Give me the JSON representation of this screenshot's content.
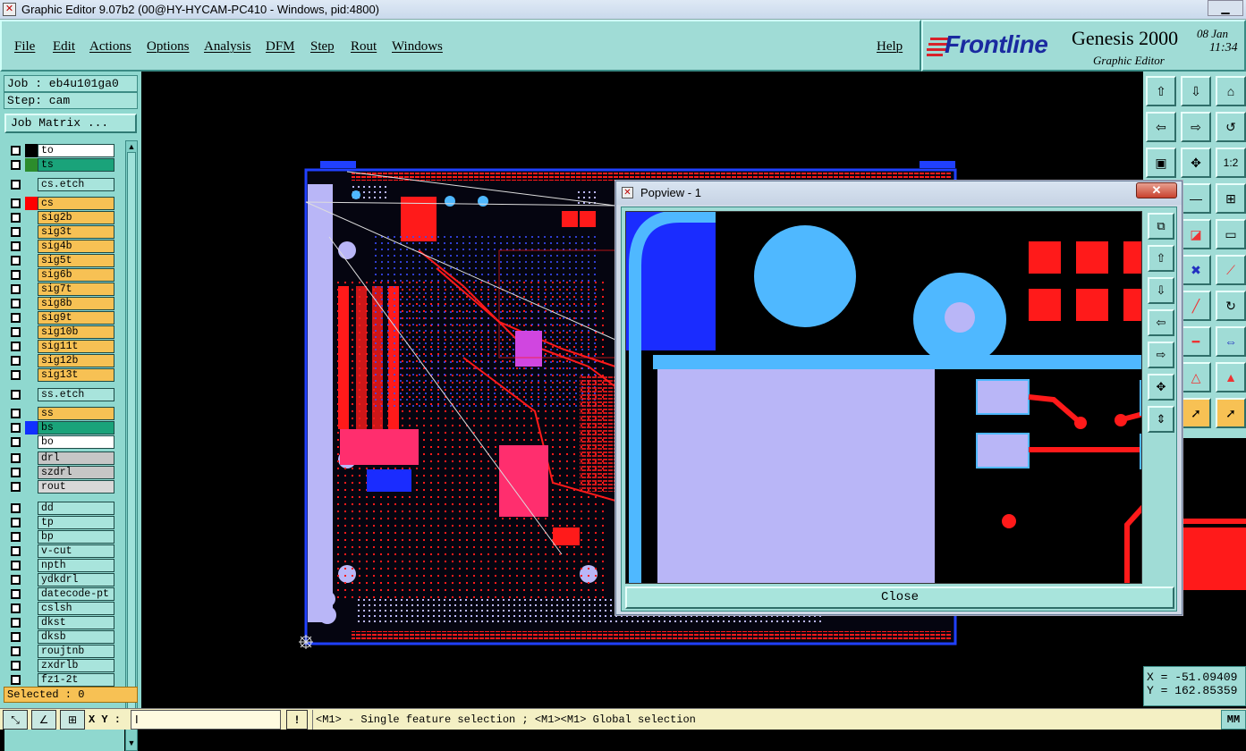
{
  "window": {
    "title": "Graphic Editor 9.07b2 (00@HY-HYCAM-PC410 - Windows, pid:4800)",
    "app_icon": "x-logo-icon"
  },
  "menu": {
    "items": [
      "File",
      "Edit",
      "Actions",
      "Options",
      "Analysis",
      "DFM",
      "Step",
      "Rout",
      "Windows"
    ],
    "help": "Help"
  },
  "brand": {
    "logo": "Frontline",
    "product": "Genesis 2000",
    "subtitle": "Graphic Editor",
    "date": "08 Jan",
    "time": "11:34"
  },
  "job": {
    "job_label": "Job : eb4u101ga0",
    "step_label": "Step: cam",
    "matrix_button": "Job Matrix ..."
  },
  "layers": [
    {
      "name": "to",
      "color": "#ffffff",
      "swatch": "#000000",
      "group": 0
    },
    {
      "name": "ts",
      "color": "#1aa37a",
      "swatch": "#2c8c2c",
      "group": 0
    },
    {
      "name": "cs.etch",
      "color": "#a8e4dc",
      "swatch": "",
      "group": 1
    },
    {
      "name": "cs",
      "color": "#f7c154",
      "swatch": "#ff0000",
      "group": 2
    },
    {
      "name": "sig2b",
      "color": "#f7c154",
      "swatch": "",
      "group": 2
    },
    {
      "name": "sig3t",
      "color": "#f7c154",
      "swatch": "",
      "group": 2
    },
    {
      "name": "sig4b",
      "color": "#f7c154",
      "swatch": "",
      "group": 2
    },
    {
      "name": "sig5t",
      "color": "#f7c154",
      "swatch": "",
      "group": 2
    },
    {
      "name": "sig6b",
      "color": "#f7c154",
      "swatch": "",
      "group": 2
    },
    {
      "name": "sig7t",
      "color": "#f7c154",
      "swatch": "",
      "group": 2
    },
    {
      "name": "sig8b",
      "color": "#f7c154",
      "swatch": "",
      "group": 2
    },
    {
      "name": "sig9t",
      "color": "#f7c154",
      "swatch": "",
      "group": 2
    },
    {
      "name": "sig10b",
      "color": "#f7c154",
      "swatch": "",
      "group": 2
    },
    {
      "name": "sig11t",
      "color": "#f7c154",
      "swatch": "",
      "group": 2
    },
    {
      "name": "sig12b",
      "color": "#f7c154",
      "swatch": "",
      "group": 2
    },
    {
      "name": "sig13t",
      "color": "#f7c154",
      "swatch": "",
      "group": 2
    },
    {
      "name": "ss.etch",
      "color": "#a8e4dc",
      "swatch": "",
      "group": 3
    },
    {
      "name": "ss",
      "color": "#f7c154",
      "swatch": "",
      "group": 4
    },
    {
      "name": "bs",
      "color": "#1aa37a",
      "swatch": "#1030ff",
      "group": 4
    },
    {
      "name": "bo",
      "color": "#ffffff",
      "swatch": "",
      "group": 4
    },
    {
      "name": "drl",
      "color": "#c6c6c6",
      "swatch": "",
      "group": 5
    },
    {
      "name": "szdrl",
      "color": "#c6c6c6",
      "swatch": "",
      "group": 5
    },
    {
      "name": "rout",
      "color": "#d8d8d8",
      "swatch": "",
      "group": 5
    },
    {
      "name": "dd",
      "color": "#a8e4dc",
      "swatch": "",
      "group": 6
    },
    {
      "name": "tp",
      "color": "#a8e4dc",
      "swatch": "",
      "group": 6
    },
    {
      "name": "bp",
      "color": "#a8e4dc",
      "swatch": "",
      "group": 6
    },
    {
      "name": "v-cut",
      "color": "#a8e4dc",
      "swatch": "",
      "group": 6
    },
    {
      "name": "npth",
      "color": "#a8e4dc",
      "swatch": "",
      "group": 6
    },
    {
      "name": "ydkdrl",
      "color": "#a8e4dc",
      "swatch": "",
      "group": 6
    },
    {
      "name": "datecode-pt",
      "color": "#a8e4dc",
      "swatch": "",
      "group": 6
    },
    {
      "name": "cslsh",
      "color": "#a8e4dc",
      "swatch": "",
      "group": 6
    },
    {
      "name": "dkst",
      "color": "#a8e4dc",
      "swatch": "",
      "group": 6
    },
    {
      "name": "dksb",
      "color": "#a8e4dc",
      "swatch": "",
      "group": 6
    },
    {
      "name": "roujtnb",
      "color": "#a8e4dc",
      "swatch": "",
      "group": 6
    },
    {
      "name": "zxdrlb",
      "color": "#a8e4dc",
      "swatch": "",
      "group": 6
    },
    {
      "name": "fz1-2t",
      "color": "#a8e4dc",
      "swatch": "",
      "group": 6
    }
  ],
  "selected": "Selected : 0",
  "popup": {
    "title": "Popview - 1",
    "close_label": "Close"
  },
  "coords": {
    "x": "X = -51.09409",
    "y": "Y = 162.85359"
  },
  "bottom": {
    "xy_label": "X Y :",
    "xy_value": "I",
    "alert": "!",
    "hint": "<M1> - Single feature selection ; <M1><M1> Global selection",
    "units": "MM"
  },
  "colors": {
    "panel": "#a0dcd6",
    "signal": "#ff1a1a",
    "bottom_layer": "#1a2cff",
    "pad_light": "#b9b6f7",
    "via_cyan": "#4fb8ff"
  }
}
